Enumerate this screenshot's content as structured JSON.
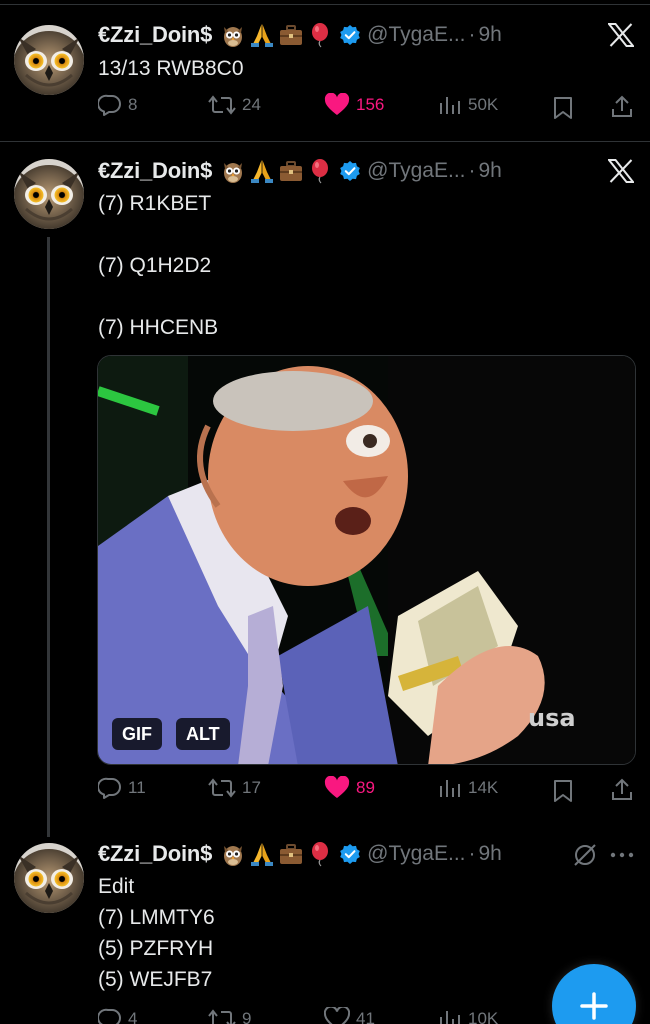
{
  "colors": {
    "accent": "#1d9bf0",
    "like": "#f91880",
    "muted": "#71767b",
    "text": "#e7e9ea",
    "background": "#000000"
  },
  "tweets": [
    {
      "author_name": "€Zzi_Doin$",
      "author_emojis": [
        "owl",
        "folded-hands",
        "briefcase",
        "balloon"
      ],
      "handle": "@TygaE...",
      "separator": "·",
      "time": "9h",
      "corner_icon": "x-logo-icon",
      "body": "13/13 RWB8C0",
      "replies": "8",
      "reposts": "24",
      "likes": "156",
      "liked": true,
      "views": "50K"
    },
    {
      "author_name": "€Zzi_Doin$",
      "author_emojis": [
        "owl",
        "folded-hands",
        "briefcase",
        "balloon"
      ],
      "handle": "@TygaE...",
      "separator": "·",
      "time": "9h",
      "corner_icon": "x-logo-icon",
      "body": "(7) R1KBET\n\n(7) Q1H2D2\n\n(7) HHCENB",
      "media": {
        "type": "gif",
        "gif_badge": "GIF",
        "alt_badge": "ALT",
        "watermark": "usa"
      },
      "replies": "11",
      "reposts": "17",
      "likes": "89",
      "liked": true,
      "views": "14K"
    },
    {
      "author_name": "€Zzi_Doin$",
      "author_emojis": [
        "owl",
        "folded-hands",
        "briefcase",
        "balloon"
      ],
      "handle": "@TygaE...",
      "separator": "·",
      "time": "9h",
      "corner_icon": "grok-icon",
      "more_icon": "more-icon",
      "body": "Edit\n(7) LMMTY6\n(5) PZFRYH\n(5) WEJFB7",
      "replies": "4",
      "reposts": "9",
      "likes": "41",
      "liked": false,
      "views": "10K"
    }
  ],
  "fab": {
    "icon": "plus-icon"
  }
}
